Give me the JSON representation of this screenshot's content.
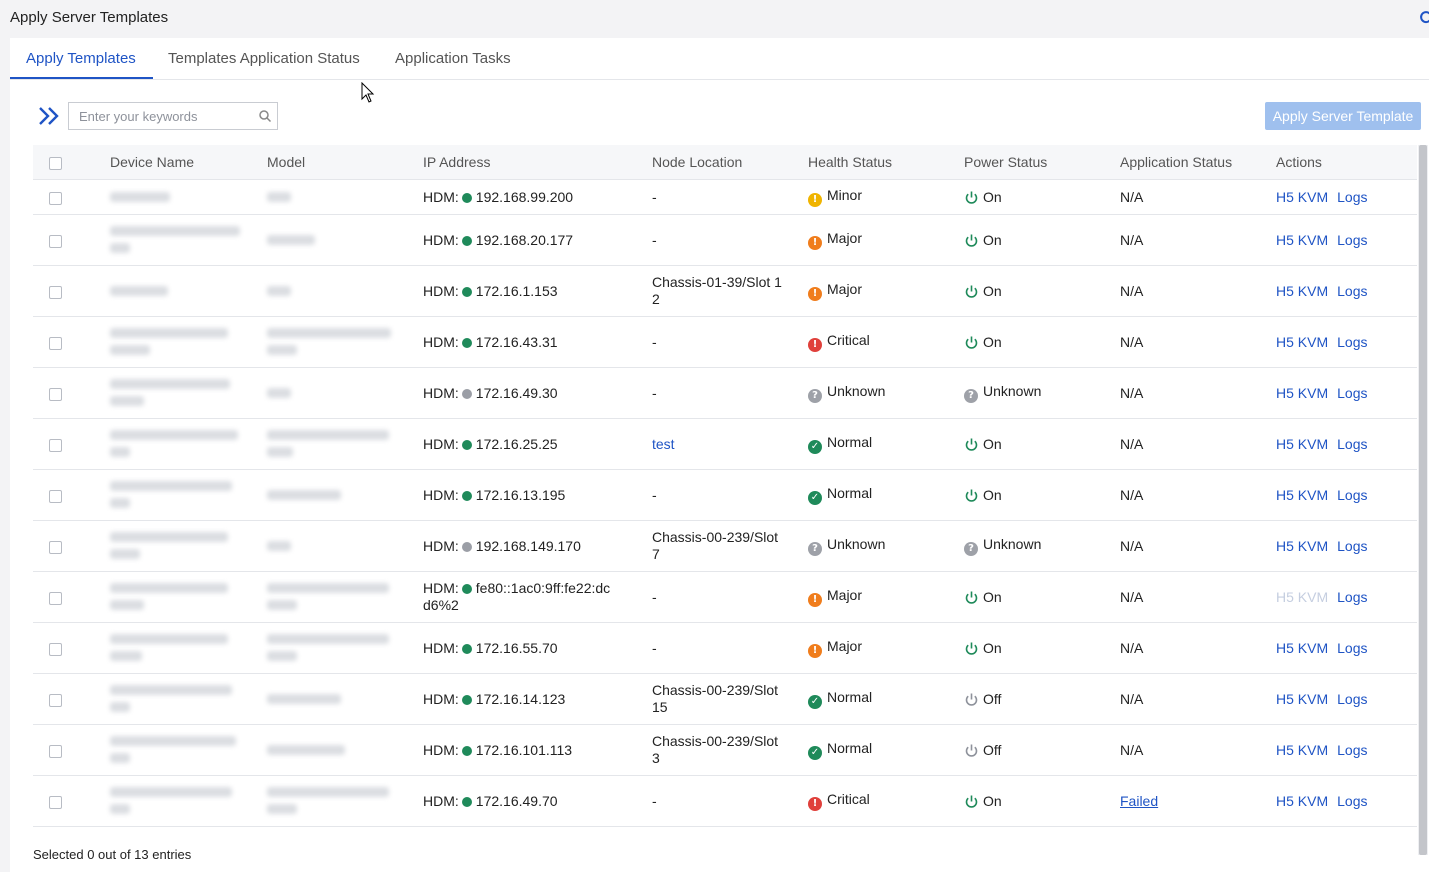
{
  "page_title": "Apply Server Templates",
  "tabs": [
    {
      "label": "Apply Templates",
      "active": true
    },
    {
      "label": "Templates Application Status",
      "active": false
    },
    {
      "label": "Application Tasks",
      "active": false
    }
  ],
  "search": {
    "placeholder": "Enter your keywords",
    "value": ""
  },
  "apply_button": {
    "label": "Apply Server Template",
    "disabled": true
  },
  "columns": [
    "Device Name",
    "Model",
    "IP Address",
    "Node Location",
    "Health Status",
    "Power Status",
    "Application Status",
    "Actions"
  ],
  "rows": [
    {
      "ip_prefix": "HDM:",
      "ip_state": "green",
      "ip": "192.168.99.200",
      "location": "-",
      "location_link": false,
      "health": "Minor",
      "power": "On",
      "app_status": "N/A",
      "app_status_link": false,
      "kvm": "H5 KVM",
      "kvm_enabled": true,
      "logs": "Logs"
    },
    {
      "ip_prefix": "HDM:",
      "ip_state": "green",
      "ip": "192.168.20.177",
      "location": "-",
      "location_link": false,
      "health": "Major",
      "power": "On",
      "app_status": "N/A",
      "app_status_link": false,
      "kvm": "H5 KVM",
      "kvm_enabled": true,
      "logs": "Logs"
    },
    {
      "ip_prefix": "HDM:",
      "ip_state": "green",
      "ip": "172.16.1.153",
      "location": "Chassis-01-39/Slot 1 2",
      "location_link": false,
      "health": "Major",
      "power": "On",
      "app_status": "N/A",
      "app_status_link": false,
      "kvm": "H5 KVM",
      "kvm_enabled": true,
      "logs": "Logs"
    },
    {
      "ip_prefix": "HDM:",
      "ip_state": "green",
      "ip": "172.16.43.31",
      "location": "-",
      "location_link": false,
      "health": "Critical",
      "power": "On",
      "app_status": "N/A",
      "app_status_link": false,
      "kvm": "H5 KVM",
      "kvm_enabled": true,
      "logs": "Logs"
    },
    {
      "ip_prefix": "HDM:",
      "ip_state": "gray",
      "ip": "172.16.49.30",
      "location": "-",
      "location_link": false,
      "health": "Unknown",
      "power": "Unknown",
      "app_status": "N/A",
      "app_status_link": false,
      "kvm": "H5 KVM",
      "kvm_enabled": true,
      "logs": "Logs"
    },
    {
      "ip_prefix": "HDM:",
      "ip_state": "green",
      "ip": "172.16.25.25",
      "location": "test",
      "location_link": true,
      "health": "Normal",
      "power": "On",
      "app_status": "N/A",
      "app_status_link": false,
      "kvm": "H5 KVM",
      "kvm_enabled": true,
      "logs": "Logs"
    },
    {
      "ip_prefix": "HDM:",
      "ip_state": "green",
      "ip": "172.16.13.195",
      "location": "-",
      "location_link": false,
      "health": "Normal",
      "power": "On",
      "app_status": "N/A",
      "app_status_link": false,
      "kvm": "H5 KVM",
      "kvm_enabled": true,
      "logs": "Logs"
    },
    {
      "ip_prefix": "HDM:",
      "ip_state": "gray",
      "ip": "192.168.149.170",
      "location": "Chassis-00-239/Slot 7",
      "location_link": false,
      "health": "Unknown",
      "power": "Unknown",
      "app_status": "N/A",
      "app_status_link": false,
      "kvm": "H5 KVM",
      "kvm_enabled": true,
      "logs": "Logs"
    },
    {
      "ip_prefix": "HDM:",
      "ip_state": "green",
      "ip": "fe80::1ac0:9ff:fe22:dcd6%2",
      "location": "-",
      "location_link": false,
      "health": "Major",
      "power": "On",
      "app_status": "N/A",
      "app_status_link": false,
      "kvm": "H5 KVM",
      "kvm_enabled": false,
      "logs": "Logs"
    },
    {
      "ip_prefix": "HDM:",
      "ip_state": "green",
      "ip": "172.16.55.70",
      "location": "-",
      "location_link": false,
      "health": "Major",
      "power": "On",
      "app_status": "N/A",
      "app_status_link": false,
      "kvm": "H5 KVM",
      "kvm_enabled": true,
      "logs": "Logs"
    },
    {
      "ip_prefix": "HDM:",
      "ip_state": "green",
      "ip": "172.16.14.123",
      "location": "Chassis-00-239/Slot 15",
      "location_link": false,
      "health": "Normal",
      "power": "Off",
      "app_status": "N/A",
      "app_status_link": false,
      "kvm": "H5 KVM",
      "kvm_enabled": true,
      "logs": "Logs"
    },
    {
      "ip_prefix": "HDM:",
      "ip_state": "green",
      "ip": "172.16.101.113",
      "location": "Chassis-00-239/Slot 3",
      "location_link": false,
      "health": "Normal",
      "power": "Off",
      "app_status": "N/A",
      "app_status_link": false,
      "kvm": "H5 KVM",
      "kvm_enabled": true,
      "logs": "Logs"
    },
    {
      "ip_prefix": "HDM:",
      "ip_state": "green",
      "ip": "172.16.49.70",
      "location": "-",
      "location_link": false,
      "health": "Critical",
      "power": "On",
      "app_status": "Failed",
      "app_status_link": true,
      "kvm": "H5 KVM",
      "kvm_enabled": true,
      "logs": "Logs"
    }
  ],
  "footer": "Selected 0 out of 13 entries",
  "colors": {
    "accent": "#1f54c5",
    "green": "#1f8a5a",
    "minor": "#f0b400",
    "major": "#f07d1c",
    "critical": "#e0403b",
    "unknown": "#9ea1a8"
  }
}
